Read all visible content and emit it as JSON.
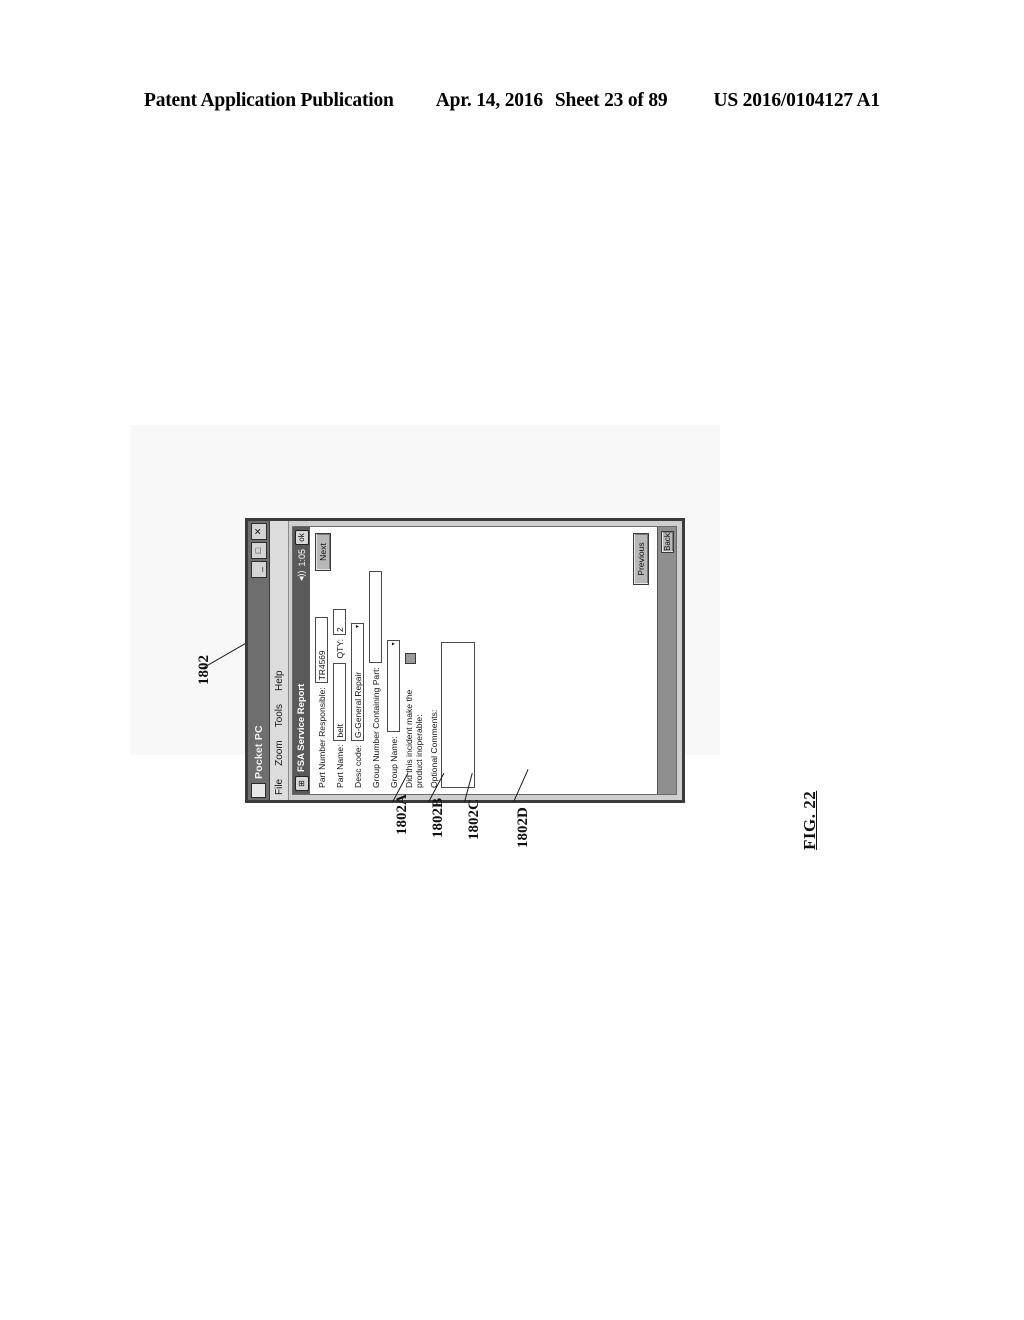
{
  "header": {
    "publication": "Patent Application Publication",
    "date": "Apr. 14, 2016",
    "sheet": "Sheet 23 of 89",
    "pub_number": "US 2016/0104127 A1"
  },
  "figure": {
    "label": "FIG. 22",
    "main_callout": "1802",
    "callouts": [
      "1802A",
      "1802B",
      "1802C",
      "1802D"
    ]
  },
  "emulator": {
    "title": "Pocket PC",
    "app_icon": "app-icon",
    "window_buttons": [
      {
        "name": "minimize",
        "glyph": "_"
      },
      {
        "name": "maximize",
        "glyph": "□"
      },
      {
        "name": "close",
        "glyph": "✕"
      }
    ],
    "menu": [
      "File",
      "Zoom",
      "Tools",
      "Help"
    ]
  },
  "pda": {
    "start_glyph": "⊞",
    "screen_title": "FSA Service Report",
    "speaker_glyph": "◂))",
    "clock": "1:05",
    "ok_glyph": "ok"
  },
  "form": {
    "part_number_responsible": {
      "label": "Part Number Responsible:",
      "value": "TR4569"
    },
    "qty": {
      "label": "QTY:",
      "value": "2"
    },
    "part_name": {
      "label": "Part Name:",
      "value": "belt"
    },
    "desc_code": {
      "label": "Desc code:",
      "value": "G-General Repair",
      "arrow": "▾"
    },
    "group_number": {
      "label": "Group Number Containing Part:",
      "value": ""
    },
    "group_name": {
      "label": "Group Name:",
      "value": "",
      "arrow": "▾"
    },
    "inoperable": {
      "label": "Did this incident make the product inoperable:",
      "checked": true
    },
    "optional_comments": {
      "label": "Optional Comments:",
      "value": ""
    },
    "buttons": {
      "next": "Next",
      "previous": "Previous",
      "back": "Back"
    }
  }
}
